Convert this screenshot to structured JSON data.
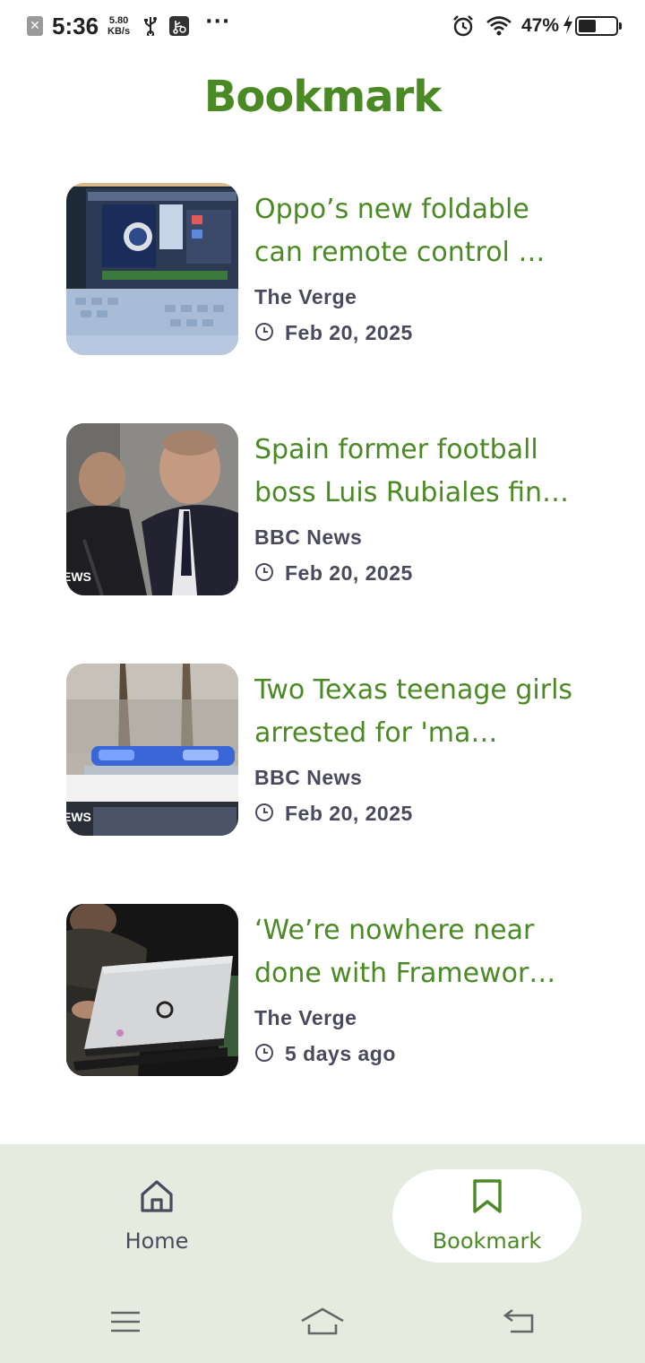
{
  "status_bar": {
    "time": "5:36",
    "speed_value": "5.80",
    "speed_unit": "KB/s",
    "more": "···",
    "battery_pct": "47%",
    "battery_level": 0.47
  },
  "header": {
    "title": "Bookmark"
  },
  "articles": [
    {
      "title": "Oppo’s new foldable can remote control …",
      "source": "The Verge",
      "date": "Feb 20, 2025",
      "thumb": "foldable-tablet-photo"
    },
    {
      "title": "Spain former football boss Luis Rubiales fin…",
      "source": "BBC News",
      "date": "Feb 20, 2025",
      "thumb": "men-in-suits-photo",
      "thumb_overlay": "EWS"
    },
    {
      "title": "Two Texas teenage girls arrested for 'ma…",
      "source": "BBC News",
      "date": "Feb 20, 2025",
      "thumb": "police-car-lights-photo",
      "thumb_overlay": "EWS"
    },
    {
      "title": "‘We’re nowhere near done with Framewor…",
      "source": "The Verge",
      "date": "5 days ago",
      "thumb": "laptop-photo"
    }
  ],
  "bottom_nav": {
    "home_label": "Home",
    "bookmark_label": "Bookmark",
    "active": "bookmark"
  },
  "colors": {
    "accent": "#4a8a24",
    "text_secondary": "#4a4a5e",
    "nav_bg": "#e6ebe0"
  }
}
